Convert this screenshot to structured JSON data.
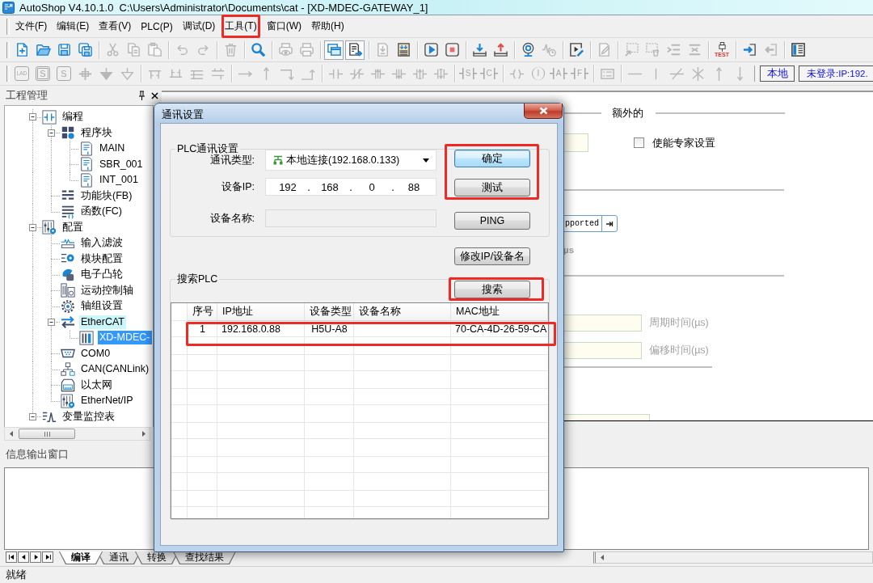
{
  "window": {
    "title": "AutoShop V4.10.1.0  C:\\Users\\Administrator\\Documents\\cat - [XD-MDEC-GATEWAY_1]"
  },
  "menu": {
    "items": [
      {
        "label": "文件(F)",
        "highlighted": false
      },
      {
        "label": "编辑(E)",
        "highlighted": false
      },
      {
        "label": "查看(V)",
        "highlighted": false
      },
      {
        "label": "PLC(P)",
        "highlighted": false
      },
      {
        "label": "调试(D)",
        "highlighted": false
      },
      {
        "label": "工具(T)",
        "highlighted": true
      },
      {
        "label": "窗口(W)",
        "highlighted": false
      },
      {
        "label": "帮助(H)",
        "highlighted": false
      }
    ]
  },
  "toolbars": [
    {
      "items": [
        {
          "kind": "button",
          "disabled": false,
          "pressed": false
        },
        {
          "kind": "button",
          "disabled": false,
          "pressed": false
        },
        {
          "kind": "button",
          "disabled": false,
          "pressed": false
        },
        {
          "kind": "button",
          "disabled": false,
          "pressed": false
        },
        {
          "kind": "separator"
        },
        {
          "kind": "button",
          "disabled": true,
          "pressed": false
        },
        {
          "kind": "button",
          "disabled": true,
          "pressed": false
        },
        {
          "kind": "button",
          "disabled": true,
          "pressed": false
        },
        {
          "kind": "separator"
        },
        {
          "kind": "button",
          "disabled": true,
          "pressed": false
        },
        {
          "kind": "button",
          "disabled": true,
          "pressed": false
        },
        {
          "kind": "separator"
        },
        {
          "kind": "button",
          "disabled": true,
          "pressed": false
        },
        {
          "kind": "separator"
        },
        {
          "kind": "button",
          "disabled": false,
          "pressed": false
        },
        {
          "kind": "separator"
        },
        {
          "kind": "button",
          "disabled": true,
          "pressed": false
        },
        {
          "kind": "button",
          "disabled": true,
          "pressed": false
        },
        {
          "kind": "separator"
        },
        {
          "kind": "button",
          "disabled": false,
          "pressed": true
        },
        {
          "kind": "button",
          "disabled": false,
          "pressed": true
        },
        {
          "kind": "separator"
        },
        {
          "kind": "button",
          "disabled": true,
          "pressed": false
        },
        {
          "kind": "button",
          "disabled": false,
          "pressed": false
        },
        {
          "kind": "separator"
        },
        {
          "kind": "button",
          "disabled": false,
          "pressed": false
        },
        {
          "kind": "button",
          "disabled": false,
          "pressed": false
        },
        {
          "kind": "separator"
        },
        {
          "kind": "button",
          "disabled": false,
          "pressed": false
        },
        {
          "kind": "button",
          "disabled": false,
          "pressed": false
        },
        {
          "kind": "separator"
        },
        {
          "kind": "button",
          "disabled": false,
          "pressed": false
        },
        {
          "kind": "button",
          "disabled": true,
          "pressed": false
        },
        {
          "kind": "separator"
        },
        {
          "kind": "button",
          "disabled": false,
          "pressed": false
        },
        {
          "kind": "separator"
        },
        {
          "kind": "button",
          "disabled": true,
          "pressed": false
        },
        {
          "kind": "separator"
        },
        {
          "kind": "button",
          "disabled": true,
          "pressed": false
        },
        {
          "kind": "button",
          "disabled": true,
          "pressed": false
        },
        {
          "kind": "button",
          "disabled": true,
          "pressed": false
        },
        {
          "kind": "button",
          "disabled": true,
          "pressed": false
        },
        {
          "kind": "separator"
        },
        {
          "kind": "button",
          "disabled": false,
          "pressed": false,
          "caption": "TEST"
        },
        {
          "kind": "separator"
        },
        {
          "kind": "button",
          "disabled": false,
          "pressed": false
        },
        {
          "kind": "button",
          "disabled": true,
          "pressed": false
        },
        {
          "kind": "separator"
        },
        {
          "kind": "button",
          "disabled": false,
          "pressed": false
        }
      ]
    },
    {
      "items": [
        {
          "kind": "button",
          "disabled": true,
          "caption": "LAD"
        },
        {
          "kind": "button",
          "disabled": true,
          "caption": "S"
        },
        {
          "kind": "button",
          "disabled": true,
          "caption": "S"
        },
        {
          "kind": "button",
          "disabled": true
        },
        {
          "kind": "button",
          "disabled": true
        },
        {
          "kind": "button",
          "disabled": true
        },
        {
          "kind": "separator"
        },
        {
          "kind": "button",
          "disabled": true
        },
        {
          "kind": "button",
          "disabled": true
        },
        {
          "kind": "button",
          "disabled": true
        },
        {
          "kind": "button",
          "disabled": true
        },
        {
          "kind": "separator"
        },
        {
          "kind": "button",
          "disabled": true
        },
        {
          "kind": "button",
          "disabled": true
        },
        {
          "kind": "button",
          "disabled": true
        },
        {
          "kind": "button",
          "disabled": true
        },
        {
          "kind": "separator"
        },
        {
          "kind": "button",
          "disabled": true
        },
        {
          "kind": "button",
          "disabled": true
        },
        {
          "kind": "button",
          "disabled": true
        },
        {
          "kind": "button",
          "disabled": true
        },
        {
          "kind": "button",
          "disabled": true
        },
        {
          "kind": "button",
          "disabled": true
        },
        {
          "kind": "separator"
        },
        {
          "kind": "button",
          "disabled": true,
          "caption": "S"
        },
        {
          "kind": "button",
          "disabled": true,
          "caption": "C"
        },
        {
          "kind": "separator"
        },
        {
          "kind": "button",
          "disabled": true
        },
        {
          "kind": "button",
          "disabled": true,
          "caption": "I"
        },
        {
          "kind": "button",
          "disabled": true,
          "caption": "A"
        },
        {
          "kind": "button",
          "disabled": true,
          "caption": "F"
        },
        {
          "kind": "separator"
        },
        {
          "kind": "button",
          "disabled": true
        },
        {
          "kind": "separator"
        },
        {
          "kind": "button",
          "disabled": true
        },
        {
          "kind": "button",
          "disabled": true
        },
        {
          "kind": "button",
          "disabled": true
        },
        {
          "kind": "button",
          "disabled": true
        },
        {
          "kind": "button",
          "disabled": true
        },
        {
          "kind": "button",
          "disabled": true
        }
      ]
    }
  ],
  "connection": {
    "mode": "本地",
    "status": "未登录:IP:192."
  },
  "project_panel": {
    "title": "工程管理",
    "tree": [
      {
        "label": "编程",
        "expanded": true,
        "selected": false,
        "highlighted": false,
        "children": [
          {
            "label": "程序块",
            "expanded": true,
            "selected": false,
            "highlighted": false,
            "children": [
              {
                "label": "MAIN",
                "selected": false,
                "highlighted": false
              },
              {
                "label": "SBR_001",
                "selected": false,
                "highlighted": false
              },
              {
                "label": "INT_001",
                "selected": false,
                "highlighted": false
              }
            ]
          },
          {
            "label": "功能块(FB)",
            "selected": false,
            "highlighted": false
          },
          {
            "label": "函数(FC)",
            "selected": false,
            "highlighted": false
          }
        ]
      },
      {
        "label": "配置",
        "expanded": true,
        "selected": false,
        "highlighted": false,
        "children": [
          {
            "label": "输入滤波",
            "selected": false,
            "highlighted": false
          },
          {
            "label": "模块配置",
            "selected": false,
            "highlighted": false
          },
          {
            "label": "电子凸轮",
            "selected": false,
            "highlighted": false
          },
          {
            "label": "运动控制轴",
            "selected": false,
            "highlighted": false
          },
          {
            "label": "轴组设置",
            "selected": false,
            "highlighted": false
          },
          {
            "label": "EtherCAT",
            "expanded": true,
            "selected": false,
            "highlighted": true,
            "children": [
              {
                "label": "XD-MDEC-",
                "selected": true,
                "highlighted": false
              }
            ]
          },
          {
            "label": "COM0",
            "selected": false,
            "highlighted": false
          },
          {
            "label": "CAN(CANLink)",
            "selected": false,
            "highlighted": false
          },
          {
            "label": "以太网",
            "selected": false,
            "highlighted": false
          },
          {
            "label": "EtherNet/IP",
            "selected": false,
            "highlighted": false
          }
        ]
      },
      {
        "label": "变量监控表",
        "expanded": true,
        "selected": false,
        "highlighted": false
      }
    ]
  },
  "editor": {
    "section_title": "额外的",
    "expert_mode": {
      "label": "使能专家设置",
      "checked": false
    },
    "combo": {
      "value": "pported"
    },
    "unit": {
      "text": "µs",
      "disabled": true
    },
    "cycle_time": {
      "label": "周期时间(µs)",
      "disabled": true
    },
    "offset_time": {
      "label": "偏移时间(µs)",
      "disabled": true
    }
  },
  "dialog": {
    "title": "通讯设置",
    "plc_group": {
      "title": "PLC通讯设置",
      "comm_type": {
        "label": "通讯类型:",
        "value": "本地连接(192.168.0.133)"
      },
      "device_ip": {
        "label": "设备IP:",
        "parts": [
          "192",
          ".",
          "168",
          ".",
          "0",
          ".",
          "88"
        ]
      },
      "device_name": {
        "label": "设备名称:",
        "disabled": true
      },
      "buttons": [
        {
          "label": "确定",
          "default": true,
          "highlighted": true
        },
        {
          "label": "测试",
          "default": false,
          "highlighted": true
        },
        {
          "label": "PING",
          "default": false,
          "highlighted": false
        }
      ]
    },
    "modify_button": {
      "label": "修改IP/设备名"
    },
    "search_group": {
      "title": "搜索PLC",
      "search_button": {
        "label": "搜索",
        "highlighted": true
      },
      "table": {
        "columns": [
          "序号",
          "IP地址",
          "设备类型",
          "设备名称",
          "MAC地址"
        ],
        "rows": [
          {
            "no": "1",
            "ip_address": "192.168.0.88",
            "device_type": "H5U-A8",
            "mac_address": "70-CA-4D-26-59-CA",
            "highlighted": true
          }
        ]
      }
    }
  },
  "output_panel": {
    "title": "信息输出窗口",
    "tabs": [
      {
        "label": "编译",
        "selected": true
      },
      {
        "label": "通讯",
        "selected": false
      },
      {
        "label": "转换",
        "selected": false
      },
      {
        "label": "查找结果",
        "selected": false
      }
    ]
  },
  "status_bar": {
    "text": "就绪"
  }
}
